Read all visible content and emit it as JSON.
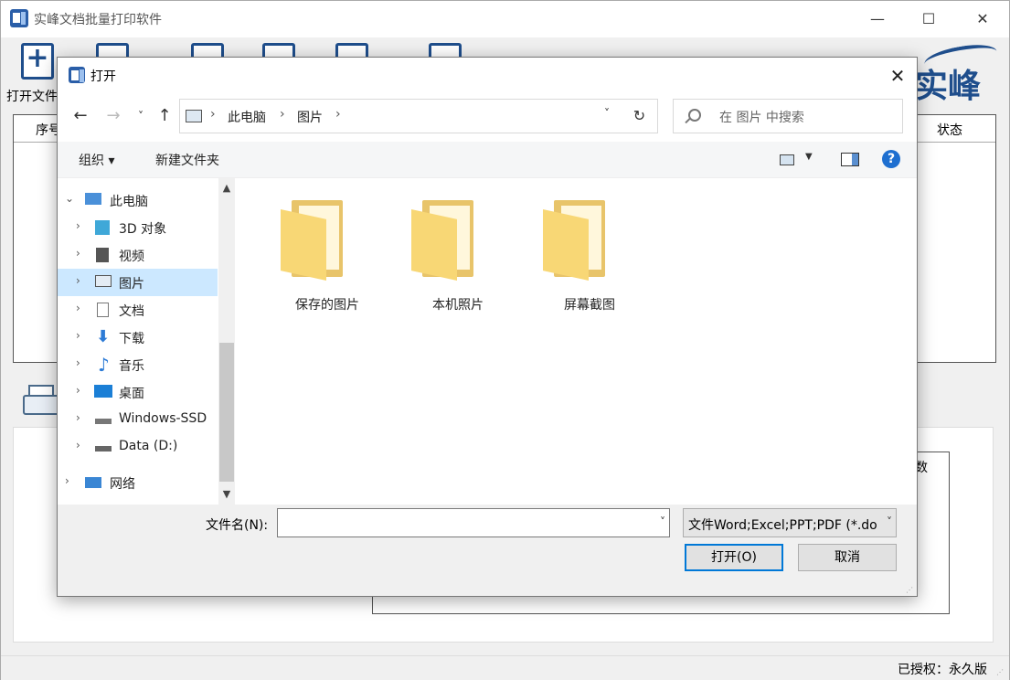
{
  "main": {
    "title": "实峰文档批量打印软件",
    "minimize": "—",
    "maximize": "☐",
    "close": "✕",
    "toolbar": {
      "open_file_label": "打开文件"
    },
    "brand": "实峰",
    "table_headers": {
      "index": "序号",
      "status": "状态"
    },
    "inner_header": "数",
    "license": "已授权：永久版"
  },
  "dialog": {
    "title": "打开",
    "close": "✕",
    "nav": {
      "back": "←",
      "forward": "→",
      "recent": "˅",
      "up": "↑"
    },
    "breadcrumb": {
      "sep": "›",
      "items": [
        "此电脑",
        "图片"
      ]
    },
    "addr_drop": "˅",
    "refresh": "↻",
    "search_placeholder": "在 图片 中搜索",
    "commands": {
      "organize": "组织 ▾",
      "new_folder": "新建文件夹"
    },
    "view_drop": "▼",
    "help": "?",
    "nav_pane": [
      {
        "label": "此电脑",
        "expander": "⌄"
      },
      {
        "label": "3D 对象",
        "expander": "›"
      },
      {
        "label": "视频",
        "expander": "›"
      },
      {
        "label": "图片",
        "expander": "›"
      },
      {
        "label": "文档",
        "expander": "›"
      },
      {
        "label": "下载",
        "expander": "›"
      },
      {
        "label": "音乐",
        "expander": "›"
      },
      {
        "label": "桌面",
        "expander": "›"
      },
      {
        "label": "Windows-SSD",
        "expander": "›"
      },
      {
        "label": "Data (D:)",
        "expander": "›"
      },
      {
        "label": "网络",
        "expander": "›"
      }
    ],
    "scroll": {
      "up": "▲",
      "down": "▼"
    },
    "folders": [
      {
        "label": "保存的图片"
      },
      {
        "label": "本机照片"
      },
      {
        "label": "屏幕截图"
      }
    ],
    "file_name_label": "文件名(N):",
    "file_name_value": "",
    "fn_drop": "˅",
    "file_type": "文件Word;Excel;PPT;PDF (*.doc",
    "ft_drop": "˅",
    "open_button": "打开(O)",
    "cancel_button": "取消"
  },
  "colors": {
    "accent": "#0078d7",
    "brand": "#1f4e8c",
    "selection": "#cce8ff",
    "folder": "#f8d775"
  }
}
